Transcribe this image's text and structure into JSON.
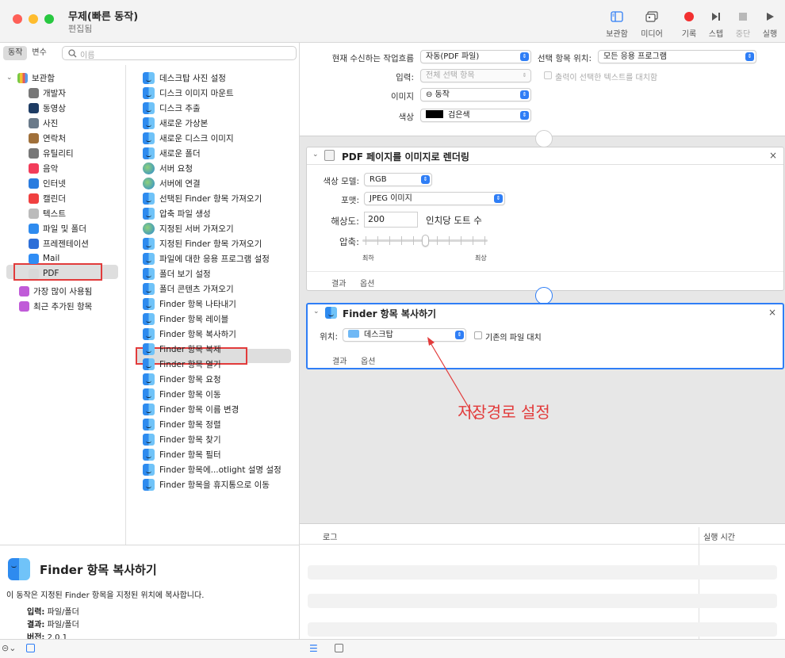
{
  "window": {
    "title": "무제(빠른 동작)",
    "subtitle": "편집됨"
  },
  "toolbar": {
    "library": "보관함",
    "media": "미디어",
    "record": "기록",
    "step": "스텝",
    "stop": "중단",
    "run": "실행"
  },
  "sidebar": {
    "tabs": [
      "동작",
      "변수"
    ],
    "search_placeholder": "이름",
    "library_root": "보관함",
    "library_items": [
      {
        "label": "개발자",
        "icon": "tools-icon",
        "color": "#777777"
      },
      {
        "label": "동영상",
        "icon": "quicktime-icon",
        "color": "#1e3c64"
      },
      {
        "label": "사진",
        "icon": "photo-icon",
        "color": "#6a7a8a"
      },
      {
        "label": "연락처",
        "icon": "contacts-icon",
        "color": "#a0703a"
      },
      {
        "label": "유틸리티",
        "icon": "utility-icon",
        "color": "#777777"
      },
      {
        "label": "음악",
        "icon": "music-icon",
        "color": "#f23c5a"
      },
      {
        "label": "인터넷",
        "icon": "internet-icon",
        "color": "#2a7cdf"
      },
      {
        "label": "캘린더",
        "icon": "calendar-icon",
        "color": "#f04040"
      },
      {
        "label": "텍스트",
        "icon": "text-icon",
        "color": "#bbbbbb"
      },
      {
        "label": "파일 및 폴더",
        "icon": "finder-icon",
        "color": "#2e8bef"
      },
      {
        "label": "프레젠테이션",
        "icon": "keynote-icon",
        "color": "#2e6fd8"
      },
      {
        "label": "Mail",
        "icon": "mail-icon",
        "color": "#2f8df5"
      },
      {
        "label": "PDF",
        "icon": "pdf-icon",
        "color": "#d8d8d8"
      }
    ],
    "smart_items": [
      {
        "label": "가장 많이 사용됨"
      },
      {
        "label": "최근 추가된 항목"
      }
    ],
    "actions": [
      {
        "label": "데스크탑 사진 설정",
        "icon": "finder"
      },
      {
        "label": "디스크 이미지 마운트",
        "icon": "finder"
      },
      {
        "label": "디스크 추출",
        "icon": "finder"
      },
      {
        "label": "새로운 가상본",
        "icon": "finder"
      },
      {
        "label": "새로운 디스크 이미지",
        "icon": "finder"
      },
      {
        "label": "새로운 폴더",
        "icon": "finder"
      },
      {
        "label": "서버 요청",
        "icon": "globe"
      },
      {
        "label": "서버에 연결",
        "icon": "globe"
      },
      {
        "label": "선택된 Finder 항목 가져오기",
        "icon": "finder"
      },
      {
        "label": "압축 파일 생성",
        "icon": "finder"
      },
      {
        "label": "지정된 서버 가져오기",
        "icon": "globe"
      },
      {
        "label": "지정된 Finder 항목 가져오기",
        "icon": "finder"
      },
      {
        "label": "파일에 대한 응용 프로그램 설정",
        "icon": "finder"
      },
      {
        "label": "폴더 보기 설정",
        "icon": "finder"
      },
      {
        "label": "폴더 콘텐츠 가져오기",
        "icon": "finder"
      },
      {
        "label": "Finder 항목 나타내기",
        "icon": "finder"
      },
      {
        "label": "Finder 항목 레이블",
        "icon": "finder"
      },
      {
        "label": "Finder 항목 복사하기",
        "icon": "finder"
      },
      {
        "label": "Finder 항목 복제",
        "icon": "finder"
      },
      {
        "label": "Finder 항목 열기",
        "icon": "finder"
      },
      {
        "label": "Finder 항목 요청",
        "icon": "finder"
      },
      {
        "label": "Finder 항목 이동",
        "icon": "finder"
      },
      {
        "label": "Finder 항목 이름 변경",
        "icon": "finder"
      },
      {
        "label": "Finder 항목 정렬",
        "icon": "finder"
      },
      {
        "label": "Finder 항목 찾기",
        "icon": "finder"
      },
      {
        "label": "Finder 항목 필터",
        "icon": "finder"
      },
      {
        "label": "Finder 항목에...otlight 설명 설정",
        "icon": "finder"
      },
      {
        "label": "Finder 항목을 휴지통으로 이동",
        "icon": "finder"
      }
    ]
  },
  "description": {
    "title": "Finder 항목 복사하기",
    "text": "이 동작은 지정된 Finder 항목을 지정된 위치에 복사합니다.",
    "input_label": "입력:",
    "input_value": "파일/폴더",
    "result_label": "결과:",
    "result_value": "파일/폴더",
    "version_label": "버전:",
    "version_value": "2.0.1"
  },
  "workflow": {
    "receives_label": "현재 수신하는 작업흐름",
    "receives_value": "자동(PDF 파일)",
    "in_label": "선택 항목 위치:",
    "in_value": "모든 응용 프로그램",
    "input_label": "입력:",
    "input_value": "전체 선택 항목",
    "replace_label": "출력이 선택한 텍스트를 대치함",
    "image_label": "이미지",
    "image_value": "⊖ 동작",
    "color_label": "색상",
    "color_value": "검은색",
    "color_swatch": "#000000"
  },
  "pdf_action": {
    "title": "PDF 페이지를 이미지로 렌더링",
    "color_model_label": "색상 모델:",
    "color_model_value": "RGB",
    "format_label": "포맷:",
    "format_value": "JPEG 이미지",
    "resolution_label": "해상도:",
    "resolution_value": "200",
    "resolution_unit": "인치당 도트 수",
    "compression_label": "압축:",
    "compression_min": "최하",
    "compression_max": "최상",
    "compression_level": 0.5,
    "results": "결과",
    "options": "옵션"
  },
  "copy_action": {
    "title": "Finder 항목 복사하기",
    "location_label": "위치:",
    "location_value": "데스크탑",
    "replace_label": "기존의 파일 대치",
    "results": "결과",
    "options": "옵션"
  },
  "annotation": {
    "text": "저장경로 설정",
    "color": "#e23b3b"
  },
  "log": {
    "col_log": "로그",
    "col_time": "실행 시간"
  }
}
